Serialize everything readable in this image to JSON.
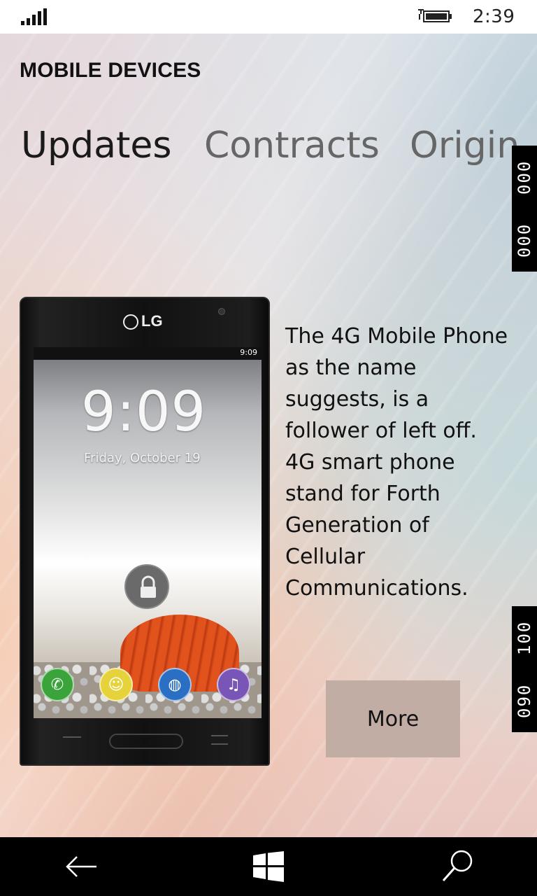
{
  "status_bar": {
    "time": "2:39",
    "signal_icon": "signal-bars-icon",
    "battery_icon": "battery-charging-icon"
  },
  "app": {
    "title": "MOBILE DEVICES"
  },
  "pivot": {
    "tabs": [
      {
        "label": "Updates",
        "active": true
      },
      {
        "label": "Contracts",
        "active": false
      },
      {
        "label": "Origin",
        "active": false
      }
    ]
  },
  "side_counters": {
    "top": [
      "000",
      "000"
    ],
    "bottom": [
      "090",
      "100"
    ]
  },
  "phone_image": {
    "brand": "LG",
    "screen_status_time": "9:09",
    "lock_time": "9:09",
    "lock_date": "Friday, October 19"
  },
  "content": {
    "description": "The 4G Mobile Phone as the name suggests, is a follower of left off. 4G smart phone stand for Forth Generation of Cellular Communications.",
    "more_label": "More"
  },
  "nav_bar": {
    "back_icon": "back-arrow-icon",
    "start_icon": "windows-logo-icon",
    "search_icon": "search-icon"
  },
  "colors": {
    "more_button_bg": "#c2ada5",
    "nav_bar_bg": "#000000"
  }
}
